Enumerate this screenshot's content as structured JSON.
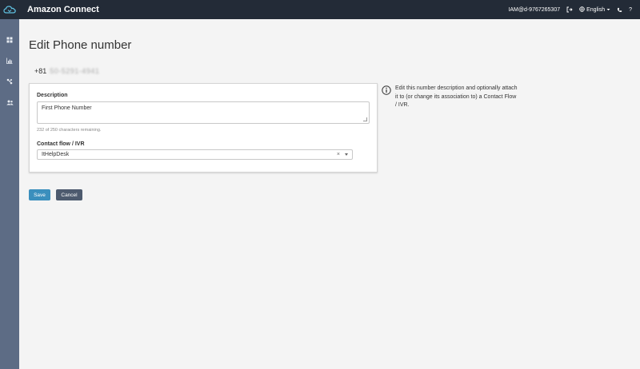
{
  "header": {
    "app_title": "Amazon Connect",
    "user_id": "IAM@d-9767265307",
    "language": "English",
    "help": "?"
  },
  "sidebar": {
    "items": [
      {
        "icon": "dashboard-icon"
      },
      {
        "icon": "metrics-icon"
      },
      {
        "icon": "routing-icon"
      },
      {
        "icon": "users-icon"
      }
    ]
  },
  "page": {
    "title": "Edit Phone number",
    "phone_prefix": "+81",
    "phone_number": "50-5291-4941"
  },
  "form": {
    "description_label": "Description",
    "description_value": "First Phone Number",
    "char_count": "232 of 250 characters remaining.",
    "contact_flow_label": "Contact flow / IVR",
    "contact_flow_value": "ItHelpDesk",
    "clear": "×"
  },
  "info": {
    "text": "Edit this number description and optionally attach it to (or change its association to) a Contact Flow / IVR."
  },
  "actions": {
    "save_label": "Save",
    "cancel_label": "Cancel"
  },
  "colors": {
    "topbar": "#232b37",
    "sidebar": "#5d6c85",
    "save": "#3b8fbd",
    "cancel": "#4d5a6e"
  }
}
